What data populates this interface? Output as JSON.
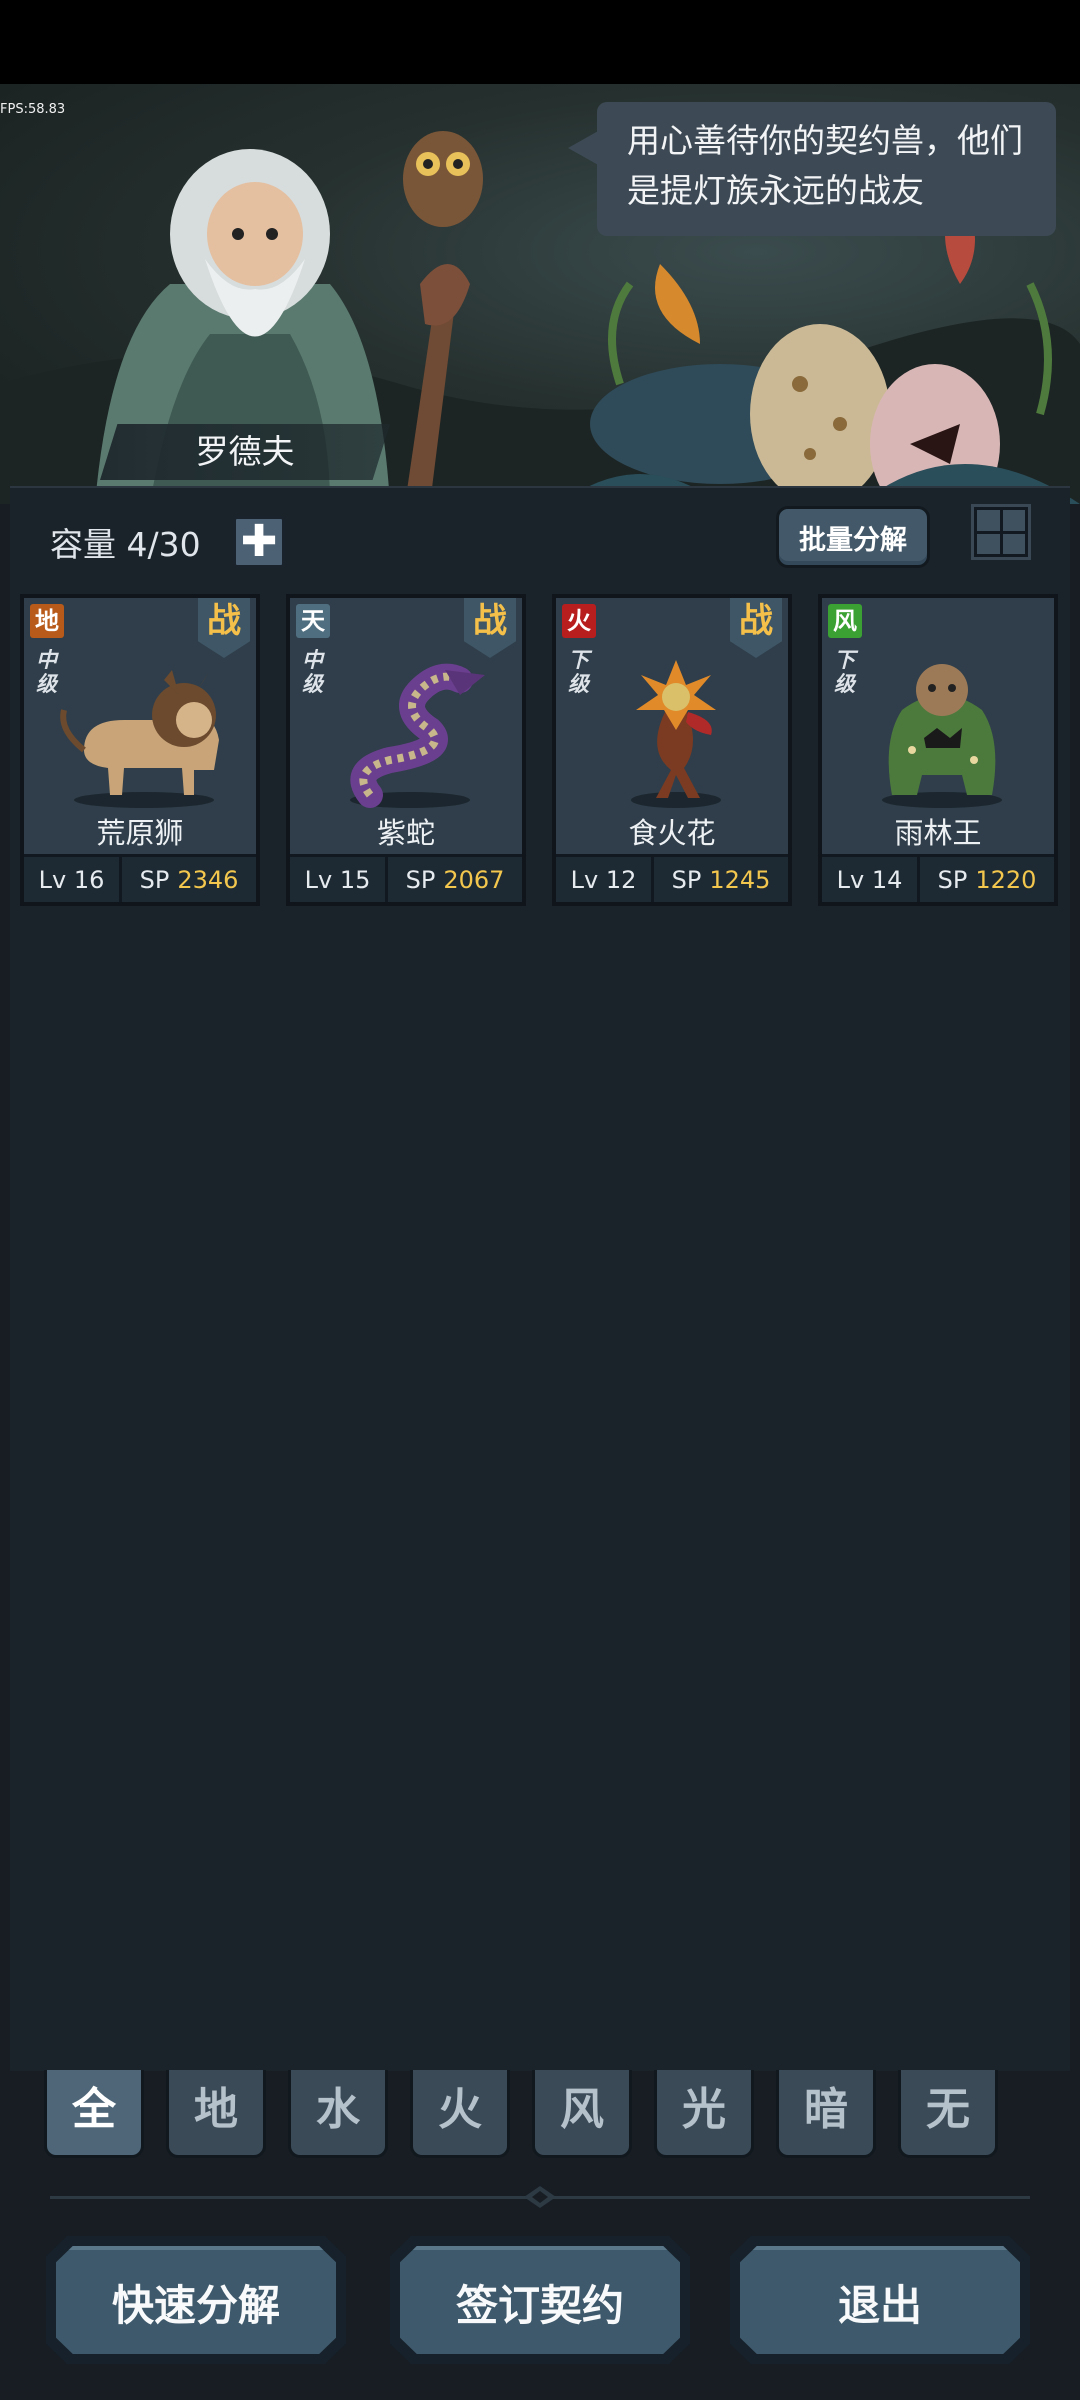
{
  "hud": {
    "fps": "FPS:58.83"
  },
  "npc": {
    "name": "罗德夫",
    "speech_line1": "用心善待你的契约兽，他们",
    "speech_line2": "是提灯族永远的战友"
  },
  "toolbar": {
    "capacity_label": "容量 4/30",
    "add_symbol": "✚",
    "batch_label": "批量分解"
  },
  "pets": [
    {
      "element": "地",
      "element_color": "#b85a1a",
      "grade": [
        "中",
        "级"
      ],
      "battle": "战",
      "name": "荒原狮",
      "lv": "Lv 16",
      "sp_label": "SP",
      "sp": "2346"
    },
    {
      "element": "天",
      "element_color": "#4f6f80",
      "grade": [
        "中",
        "级"
      ],
      "battle": "战",
      "name": "紫蛇",
      "lv": "Lv 15",
      "sp_label": "SP",
      "sp": "2067"
    },
    {
      "element": "火",
      "element_color": "#b81e1e",
      "grade": [
        "下",
        "级"
      ],
      "battle": "战",
      "name": "食火花",
      "lv": "Lv 12",
      "sp_label": "SP",
      "sp": "1245"
    },
    {
      "element": "风",
      "element_color": "#3aa132",
      "grade": [
        "下",
        "级"
      ],
      "battle": null,
      "name": "雨林王",
      "lv": "Lv 14",
      "sp_label": "SP",
      "sp": "1220"
    }
  ],
  "filters": [
    "全",
    "地",
    "水",
    "火",
    "风",
    "光",
    "暗",
    "无"
  ],
  "active_filter": "全",
  "buttons": {
    "quick_decompose": "快速分解",
    "sign_contract": "签订契约",
    "exit": "退出"
  }
}
